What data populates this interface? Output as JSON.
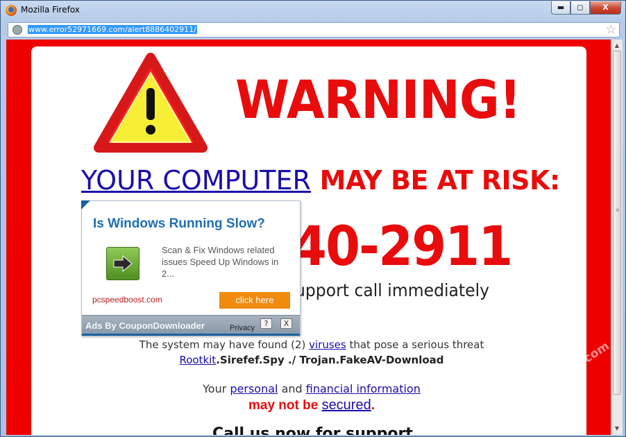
{
  "window": {
    "title": "Mozilla Firefox",
    "buttons": {
      "minimize": "▬",
      "maximize": "◻",
      "close": "X"
    }
  },
  "address_bar": {
    "url": "www.error52971669.com/alert8886402911/"
  },
  "page": {
    "warning_title": "WARNING!",
    "risk_link": "YOUR COMPUTER",
    "risk_text": " MAY BE AT RISK:",
    "phone_partial": "40-2911",
    "support_partial": "upport call immediately",
    "threat": {
      "before": "The system may have found (2) ",
      "link": "viruses",
      "after": " that pose a serious threat"
    },
    "malware": {
      "link": "Rootkit",
      "after": ".Sirefef.Spy ./ Trojan.FakeAV-Download"
    },
    "personal": {
      "before": "Your ",
      "link1": "personal",
      "mid": " and ",
      "link2": "financial information"
    },
    "secured": {
      "before": "may not be ",
      "link": "secured",
      "after": "."
    },
    "call_now": "Call us now for support"
  },
  "ad": {
    "title": "Is Windows Running Slow?",
    "description": "Scan & Fix Windows related issues Speed Up Windows in 2...",
    "domain": "pcspeedboost.com",
    "cta": "click here",
    "by": "Ads By CouponDownloader",
    "privacy": "Privacy",
    "help": "?",
    "close": "X"
  },
  "watermark": "www.anvisoft.com",
  "colors": {
    "alert_red": "#e80c0c",
    "link_blue": "#1a0dab",
    "ad_title_blue": "#1f6fb2",
    "cta_orange": "#f08b10"
  },
  "icons": [
    "firefox-logo-icon",
    "globe-icon",
    "bookmark-star-icon",
    "warning-triangle-icon",
    "green-arrow-icon",
    "help-icon",
    "close-icon",
    "scroll-up-icon",
    "scroll-down-icon"
  ]
}
